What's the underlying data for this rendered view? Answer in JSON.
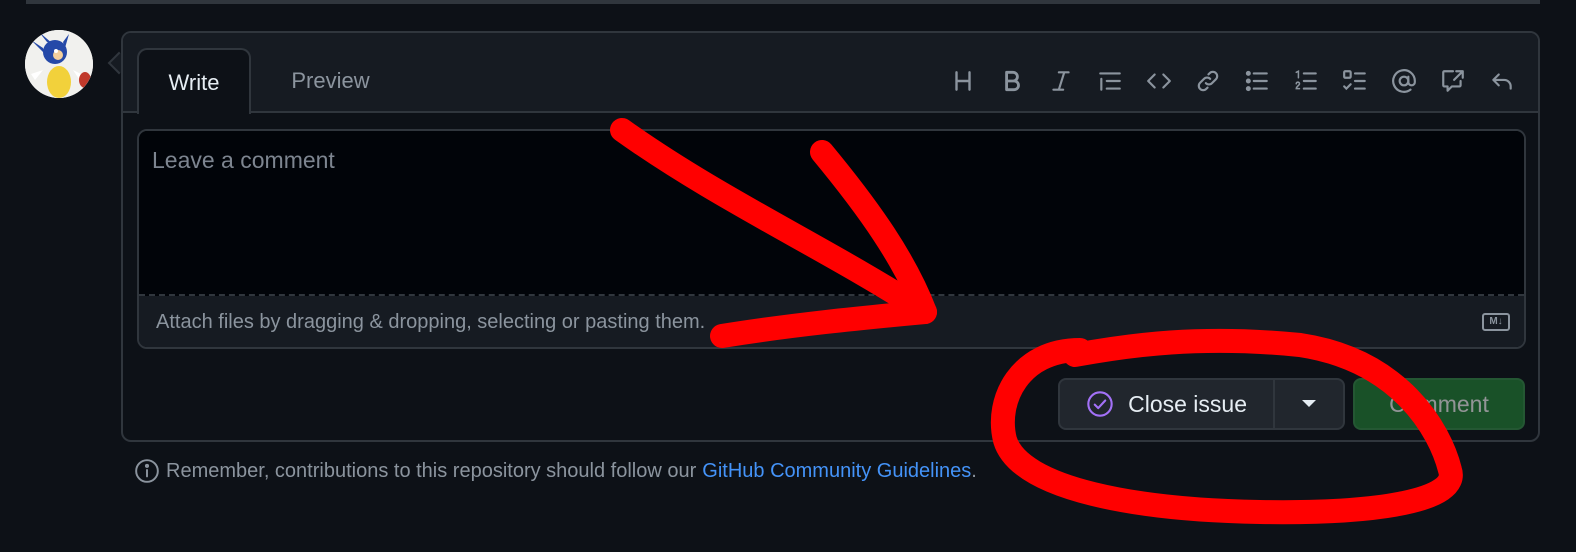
{
  "editor": {
    "tabs": [
      {
        "label": "Write",
        "active": true
      },
      {
        "label": "Preview",
        "active": false
      }
    ],
    "toolbar_icons": [
      "heading-icon",
      "bold-icon",
      "italic-icon",
      "quote-icon",
      "code-icon",
      "link-icon",
      "bulleted-list-icon",
      "numbered-list-icon",
      "task-list-icon",
      "mention-icon",
      "cross-reference-icon",
      "saved-replies-icon"
    ],
    "comment": {
      "placeholder": "Leave a comment",
      "value": ""
    },
    "attach_hint": "Attach files by dragging & dropping, selecting or pasting them.",
    "markdown_badge": "M↓"
  },
  "actions": {
    "close_issue_label": "Close issue",
    "comment_label": "Comment"
  },
  "footer": {
    "text": "Remember, contributions to this repository should follow our",
    "link_text": "GitHub Community Guidelines",
    "suffix": "."
  },
  "colors": {
    "background": "#0d1117",
    "border": "#30363d",
    "accent_link": "#4493f8",
    "close_icon": "#a371f7",
    "comment_button": "#238636",
    "annotation": "#ff0000"
  }
}
